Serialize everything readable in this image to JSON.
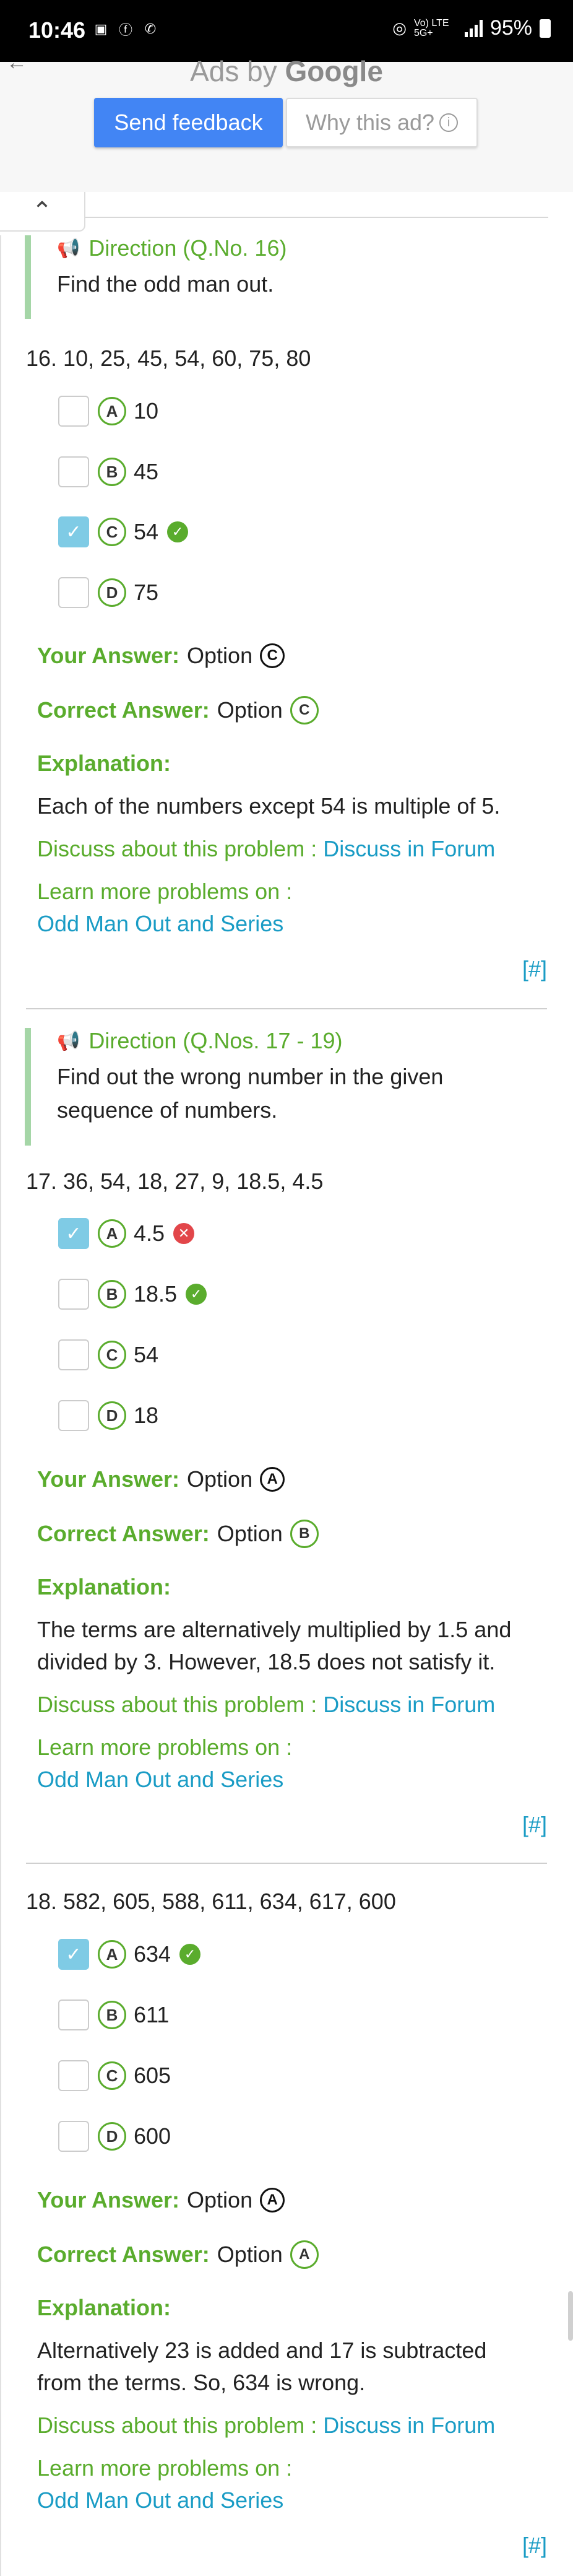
{
  "status_bar": {
    "time": "10:46",
    "battery": "95%",
    "network": "Vo) LTE 5G+"
  },
  "ad": {
    "ads_by": "Ads by",
    "brand": "Google",
    "send_feedback": "Send feedback",
    "why_this_ad": "Why this ad?",
    "back_icon": "back-arrow-icon"
  },
  "directions": [
    {
      "title": "Direction (Q.No. 16)",
      "text": "Find the odd man out."
    },
    {
      "title": "Direction (Q.Nos. 17 - 19)",
      "text_line1": "Find out the wrong number in the given",
      "text_line2": "sequence of numbers."
    }
  ],
  "q16": {
    "question": "16.  10, 25, 45, 54, 60, 75, 80",
    "options": [
      {
        "letter": "A",
        "value": "10"
      },
      {
        "letter": "B",
        "value": "45"
      },
      {
        "letter": "C",
        "value": "54"
      },
      {
        "letter": "D",
        "value": "75"
      }
    ],
    "your_answer_label": "Your Answer:",
    "your_answer_text": "Option",
    "your_answer_letter": "C",
    "correct_answer_label": "Correct Answer:",
    "correct_answer_text": "Option",
    "correct_answer_letter": "C",
    "explanation_label": "Explanation:",
    "explanation": "Each of the numbers except 54 is multiple of 5.",
    "discuss_text": "Discuss about this problem :",
    "discuss_link": "Discuss in Forum",
    "learn_text": "Learn more problems on :",
    "learn_link": "Odd Man Out and Series",
    "hash": "[#]"
  },
  "q17": {
    "question": "17.  36, 54, 18, 27, 9, 18.5, 4.5",
    "options": [
      {
        "letter": "A",
        "value": "4.5"
      },
      {
        "letter": "B",
        "value": "18.5"
      },
      {
        "letter": "C",
        "value": "54"
      },
      {
        "letter": "D",
        "value": "18"
      }
    ],
    "your_answer_label": "Your Answer:",
    "your_answer_text": "Option",
    "your_answer_letter": "A",
    "correct_answer_label": "Correct Answer:",
    "correct_answer_text": "Option",
    "correct_answer_letter": "B",
    "explanation_label": "Explanation:",
    "explanation_line1": "The terms are alternatively multiplied by 1.5 and",
    "explanation_line2": "divided by 3. However, 18.5 does not satisfy it.",
    "discuss_text": "Discuss about this problem :",
    "discuss_link": "Discuss in Forum",
    "learn_text": "Learn more problems on :",
    "learn_link": "Odd Man Out and Series",
    "hash": "[#]"
  },
  "q18": {
    "question": "18.  582, 605, 588, 611, 634, 617, 600",
    "options": [
      {
        "letter": "A",
        "value": "634"
      },
      {
        "letter": "B",
        "value": "611"
      },
      {
        "letter": "C",
        "value": "605"
      },
      {
        "letter": "D",
        "value": "600"
      }
    ],
    "your_answer_label": "Your Answer:",
    "your_answer_text": "Option",
    "your_answer_letter": "A",
    "correct_answer_label": "Correct Answer:",
    "correct_answer_text": "Option",
    "correct_answer_letter": "A",
    "explanation_label": "Explanation:",
    "explanation_line1": "Alternatively 23 is added and 17 is subtracted",
    "explanation_line2": "from the terms. So, 634 is wrong.",
    "discuss_text": "Discuss about this problem :",
    "discuss_link": "Discuss in Forum",
    "learn_text": "Learn more problems on :",
    "learn_link": "Odd Man Out and Series",
    "hash": "[#]"
  },
  "colors": {
    "accent_green": "#5aac2d",
    "link_blue": "#1a9cc5",
    "checked_box": "#7fcbe5",
    "wrong_red": "#e2464a",
    "feedback_blue": "#4285f4"
  }
}
